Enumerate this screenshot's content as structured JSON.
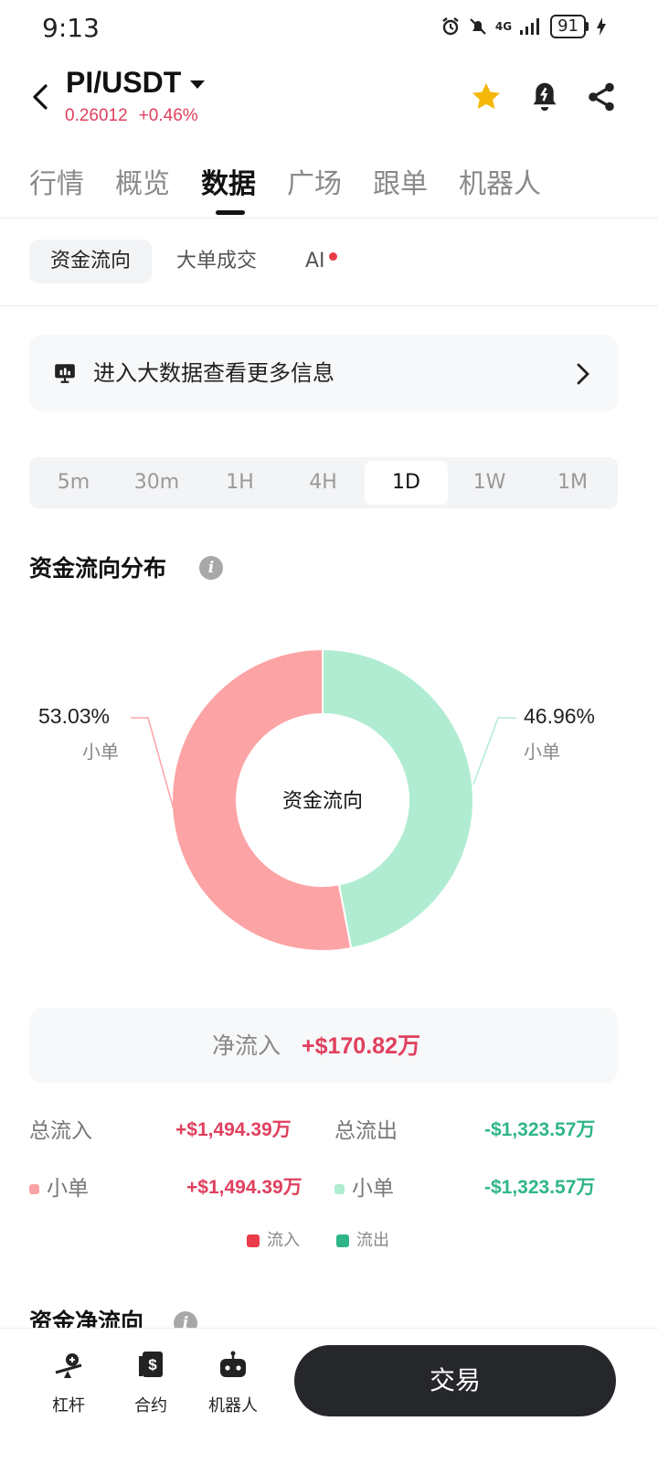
{
  "status_bar": {
    "time": "9:13",
    "network": "4G",
    "battery": "91"
  },
  "header": {
    "pair": "PI/USDT",
    "price": "0.26012",
    "change": "+0.46%"
  },
  "main_tabs": [
    "行情",
    "概览",
    "数据",
    "广场",
    "跟单",
    "机器人"
  ],
  "main_tab_active": "数据",
  "sub_tabs": [
    "资金流向",
    "大单成交",
    "AI"
  ],
  "sub_tab_active": "资金流向",
  "banner": {
    "text": "进入大数据查看更多信息"
  },
  "timeframes": [
    "5m",
    "30m",
    "1H",
    "4H",
    "1D",
    "1W",
    "1M"
  ],
  "timeframe_active": "1D",
  "section_title": "资金流向分布",
  "chart_data": {
    "type": "pie",
    "center_label": "资金流向",
    "slices": [
      {
        "label": "小单",
        "value": 53.03,
        "display": "53.03%",
        "series": "流入",
        "color": "#fca3a5"
      },
      {
        "label": "小单",
        "value": 46.96,
        "display": "46.96%",
        "series": "流出",
        "color": "#b0ecd1"
      }
    ]
  },
  "summary": {
    "net_label": "净流入",
    "net_value": "+$170.82万",
    "total_in_label": "总流入",
    "total_in_value": "+$1,494.39万",
    "total_out_label": "总流出",
    "total_out_value": "-$1,323.57万",
    "small_in_label": "小单",
    "small_in_value": "+$1,494.39万",
    "small_out_label": "小单",
    "small_out_value": "-$1,323.57万"
  },
  "legend": {
    "in": "流入",
    "out": "流出"
  },
  "colors": {
    "in": "#ea3b4a",
    "out": "#2fb688",
    "in_light": "#fca3a5",
    "out_light": "#b0ecd1",
    "accent": "#e0405e"
  },
  "section2_title": "资金净流向",
  "bottom_nav": [
    {
      "label": "杠杆",
      "icon": "leverage-icon"
    },
    {
      "label": "合约",
      "icon": "contract-icon"
    },
    {
      "label": "机器人",
      "icon": "robot-icon"
    }
  ],
  "trade_button": "交易"
}
